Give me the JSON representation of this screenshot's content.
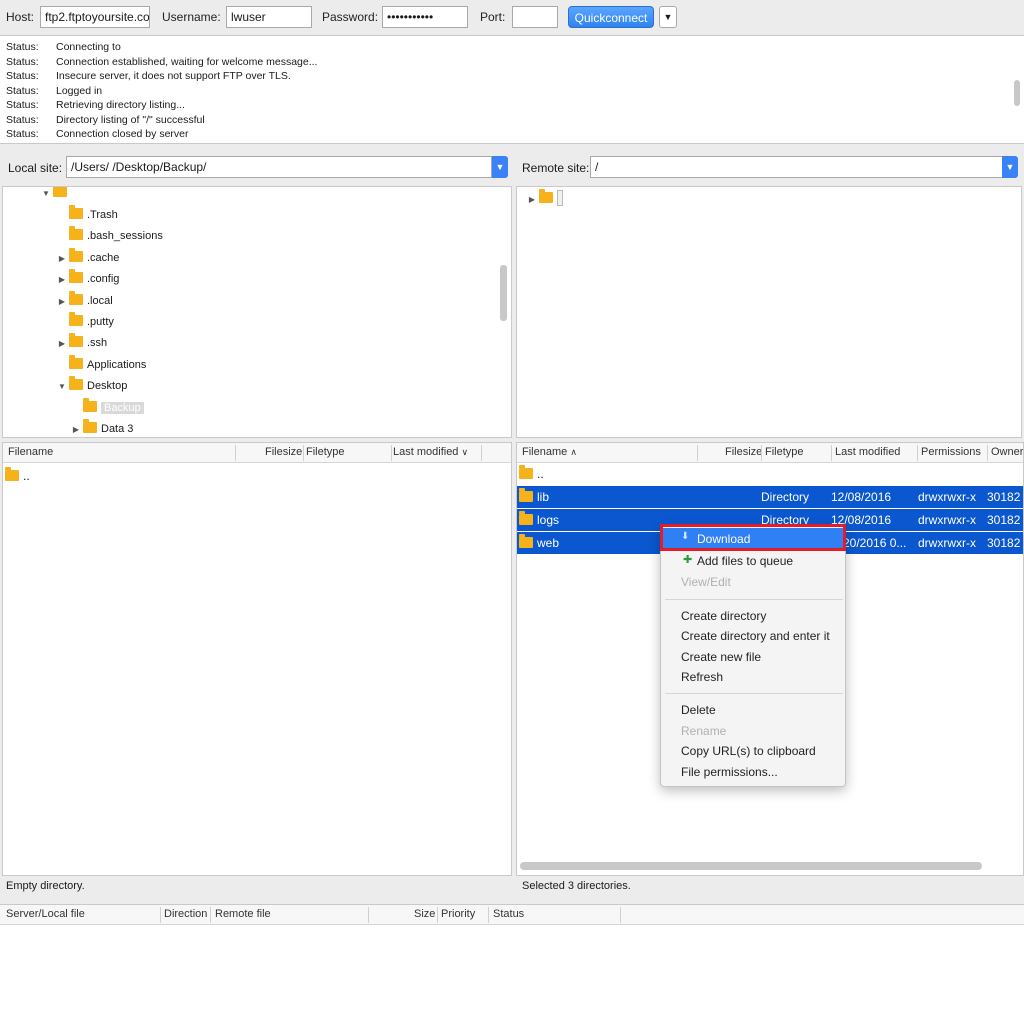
{
  "toolbar": {
    "host_label": "Host:",
    "host_value": "ftp2.ftptoyoursite.co",
    "username_label": "Username:",
    "username_value": "lwuser",
    "password_label": "Password:",
    "password_value": "•••••••••••",
    "port_label": "Port:",
    "port_value": "",
    "quickconnect_label": "Quickconnect",
    "dropdown_icon": "chevron-down-icon"
  },
  "log": [
    {
      "k": "Status:",
      "v": "Connecting to"
    },
    {
      "k": "Status:",
      "v": "Connection established, waiting for welcome message..."
    },
    {
      "k": "Status:",
      "v": "Insecure server, it does not support FTP over TLS."
    },
    {
      "k": "Status:",
      "v": "Logged in"
    },
    {
      "k": "Status:",
      "v": "Retrieving directory listing..."
    },
    {
      "k": "Status:",
      "v": "Directory listing of \"/\" successful"
    },
    {
      "k": "Status:",
      "v": "Connection closed by server"
    }
  ],
  "local_site": {
    "label": "Local site:",
    "path": "/Users/               /Desktop/Backup/"
  },
  "remote_site": {
    "label": "Remote site:",
    "path": "/"
  },
  "local_tree": [
    {
      "name": ".Trash"
    },
    {
      "name": ".bash_sessions"
    },
    {
      "name": ".cache"
    },
    {
      "name": ".config"
    },
    {
      "name": ".local"
    },
    {
      "name": ".putty"
    },
    {
      "name": ".ssh"
    },
    {
      "name": "Applications"
    },
    {
      "name": "Desktop"
    },
    {
      "name": "Backup"
    },
    {
      "name": "Data 3"
    }
  ],
  "local_list": {
    "headers": {
      "filename": "Filename",
      "filesize": "Filesize",
      "filetype": "Filetype",
      "last_modified": "Last modified"
    },
    "rows": [
      {
        "name": ".."
      }
    ],
    "status": "Empty directory."
  },
  "remote_list": {
    "headers": {
      "filename": "Filename",
      "filesize": "Filesize",
      "filetype": "Filetype",
      "last_modified": "Last modified",
      "permissions": "Permissions",
      "owner": "Owner/"
    },
    "parent": "..",
    "rows": [
      {
        "name": "lib",
        "type": "Directory",
        "modified": "12/08/2016",
        "perms": "drwxrwxr-x",
        "owner": "30182"
      },
      {
        "name": "logs",
        "type": "Directory",
        "modified": "12/08/2016",
        "perms": "drwxrwxr-x",
        "owner": "30182"
      },
      {
        "name": "web",
        "type": "",
        "modified": "20/2016 0...",
        "perms": "drwxrwxr-x",
        "owner": "30182"
      }
    ],
    "status": "Selected 3 directories."
  },
  "context_menu": {
    "download": "Download",
    "add_to_queue": "Add files to queue",
    "view_edit": "View/Edit",
    "create_dir": "Create directory",
    "create_dir_enter": "Create directory and enter it",
    "create_file": "Create new file",
    "refresh": "Refresh",
    "delete": "Delete",
    "rename": "Rename",
    "copy_url": "Copy URL(s) to clipboard",
    "file_permissions": "File permissions..."
  },
  "queue": {
    "headers": {
      "server_local": "Server/Local file",
      "direction": "Direction",
      "remote": "Remote file",
      "size": "Size",
      "priority": "Priority",
      "status": "Status"
    }
  },
  "colors": {
    "accent": "#0b57d0",
    "folder": "#f6b21a",
    "highlight_border": "#e11d2a"
  }
}
